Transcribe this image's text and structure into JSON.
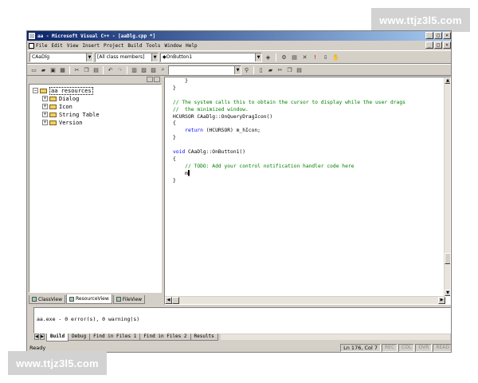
{
  "watermark": {
    "text": "www.ttjz3l5.com"
  },
  "window": {
    "title": "aa - Microsoft Visual C++ - [aaDlg.cpp *]",
    "controls": [
      "_",
      "□",
      "×"
    ],
    "mdi_controls": [
      "_",
      "□",
      "×"
    ]
  },
  "menu": [
    "File",
    "Edit",
    "View",
    "Insert",
    "Project",
    "Build",
    "Tools",
    "Window",
    "Help"
  ],
  "wizardbar": {
    "class_combo": "CAaDlg",
    "filter_combo": "[All class members]",
    "member_combo": "◆OnButton1"
  },
  "workspace": {
    "root": "aa resources",
    "items": [
      "Dialog",
      "Icon",
      "String Table",
      "Version"
    ],
    "tabs": [
      "ClassView",
      "ResourceView",
      "FileView"
    ],
    "active_tab": "ResourceView"
  },
  "editor": {
    "lines": [
      {
        "t": "    }",
        "k": "code"
      },
      {
        "t": "}",
        "k": "code"
      },
      {
        "t": "",
        "k": "code"
      },
      {
        "t": "// The system calls this to obtain the cursor to display while the user drags",
        "k": "comment"
      },
      {
        "t": "//  the minimized window.",
        "k": "comment"
      },
      {
        "t": "HCURSOR CAaDlg::OnQueryDragIcon()",
        "k": "code"
      },
      {
        "t": "{",
        "k": "code"
      },
      {
        "t": "    return (HCURSOR) m_hIcon;",
        "k": "code"
      },
      {
        "t": "}",
        "k": "code"
      },
      {
        "t": "",
        "k": "code"
      },
      {
        "t": "void CAaDlg::OnButton1()",
        "k": "code"
      },
      {
        "t": "{",
        "k": "code"
      },
      {
        "t": "    // TODO: Add your control notification handler code here",
        "k": "comment"
      },
      {
        "t": "    m▌",
        "k": "code"
      },
      {
        "t": "}",
        "k": "code"
      }
    ]
  },
  "output": {
    "text": "aa.exe - 0 error(s), 0 warning(s)",
    "tabs": [
      "Build",
      "Debug",
      "Find in Files 1",
      "Find in Files 2",
      "Results"
    ],
    "active_tab": "Build"
  },
  "status": {
    "text": "Ready",
    "position": "Ln 176, Col 7",
    "indicators": [
      "REC",
      "COL",
      "OVR",
      "READ"
    ]
  }
}
